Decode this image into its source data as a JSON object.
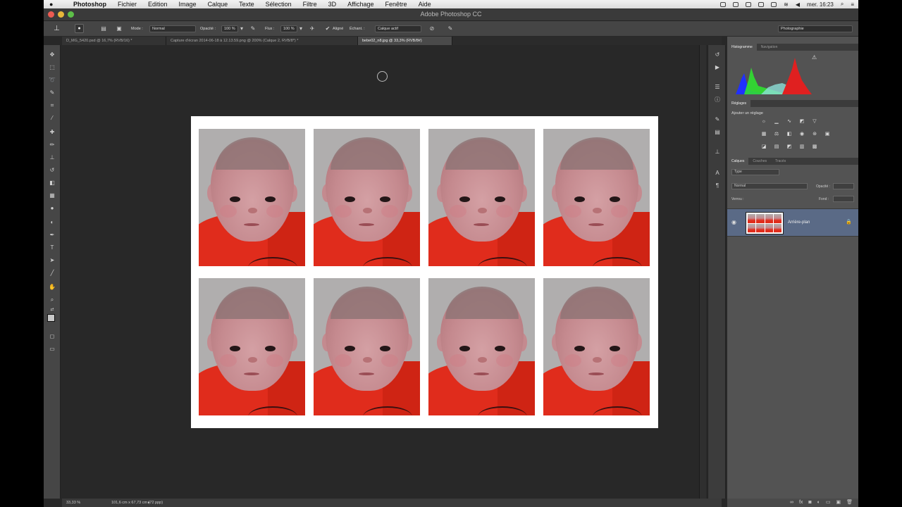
{
  "menubar": {
    "apple": "",
    "app_name": "Photoshop",
    "items": [
      "Fichier",
      "Edition",
      "Image",
      "Calque",
      "Texte",
      "Sélection",
      "Filtre",
      "3D",
      "Affichage",
      "Fenêtre",
      "Aide"
    ],
    "clock": "mer. 16:23"
  },
  "titlebar": {
    "title": "Adobe Photoshop CC"
  },
  "options": {
    "mode_label": "Mode :",
    "mode_value": "Normal",
    "opacity_label": "Opacité :",
    "opacity_value": "100 %",
    "flow_label": "Flux :",
    "flow_value": "100 %",
    "aligned_label": "Aligné",
    "sample_label": "Échant. :",
    "sample_value": "Calque actif",
    "workspace_value": "Photographie"
  },
  "tabs": [
    {
      "label": "D_MG_5420.psd @ 16,7% (RVB/16) *",
      "active": false
    },
    {
      "label": "Capture d'écran 2014-06-18 à 12.13.59.png @ 200% (Calque 2, RVB/8*) *",
      "active": false
    },
    {
      "label": "bebe02_n8.jpg @ 33,3% (RVB/8#)",
      "active": true
    }
  ],
  "toolbox": {
    "icons": [
      "move-icon",
      "marquee-icon",
      "lasso-icon",
      "quick-select-icon",
      "crop-icon",
      "eyedropper-icon",
      "healing-brush-icon",
      "brush-icon",
      "clone-stamp-icon",
      "history-brush-icon",
      "eraser-icon",
      "gradient-icon",
      "blur-icon",
      "dodge-icon",
      "pen-icon",
      "type-icon",
      "path-select-icon",
      "line-icon",
      "hand-icon",
      "zoom-icon"
    ]
  },
  "canvas": {
    "rows": 2,
    "cols": 4,
    "photo_colors": {
      "background": "#b0aeae",
      "shirt": "#e02c1c",
      "skin": "#c58a8f"
    }
  },
  "panels": {
    "histogram_tabs": [
      "Histogramme",
      "Navigation"
    ],
    "adjust_tab": "Réglages",
    "adjust_title": "Ajouter un réglage",
    "layer_tabs": [
      "Calques",
      "Couches",
      "Tracés"
    ],
    "kind_value": "Type",
    "blend_value": "Normal",
    "opacity_label": "Opacité :",
    "lock_label": "Verrou :",
    "fill_label": "Fond :",
    "layer_name": "Arrière-plan",
    "histogram_colors": {
      "blue": "#2030ff",
      "green": "#30e030",
      "red": "#e02020"
    }
  },
  "statusbar": {
    "zoom": "33,33 %",
    "doc_info": "101,6 cm x 67,73 cm (72 ppp)"
  }
}
